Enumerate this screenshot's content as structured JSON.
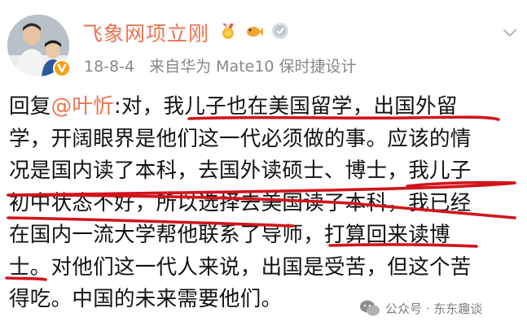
{
  "post": {
    "author": "飞象网项立刚",
    "date": "18-8-4",
    "source": "来自华为 Mate10 保时捷设计",
    "lines": [
      {
        "prefix": "回复",
        "mention": "@叶忻",
        "text": ":对，我儿子也在美国留学，出国外留"
      },
      {
        "text": "学，开阔眼界是他们这一代必须做的事。应该的情"
      },
      {
        "text": "况是国内读了本科，去国外读硕士、博士，我儿子"
      },
      {
        "text": "初中状态不好，所以选择去美国读了本科，我已经"
      },
      {
        "text": "在国内一流大学帮他联系了导师，打算回来读博"
      },
      {
        "text": "士。对他们这一代人来说，出国是受苦，但这个苦"
      },
      {
        "text": "得吃。中国的未来需要他们。"
      }
    ]
  },
  "watermark": {
    "text": "公众号 · 东东趣谈"
  },
  "colors": {
    "accent": "#eb7350",
    "underline": "#d2141c",
    "text": "#111111",
    "meta": "#888888"
  },
  "icons": [
    "avatar",
    "verified-badge-icon",
    "medal-icon",
    "fish-icon",
    "level-badge-icon",
    "chevron-down-icon",
    "wechat-icon"
  ]
}
